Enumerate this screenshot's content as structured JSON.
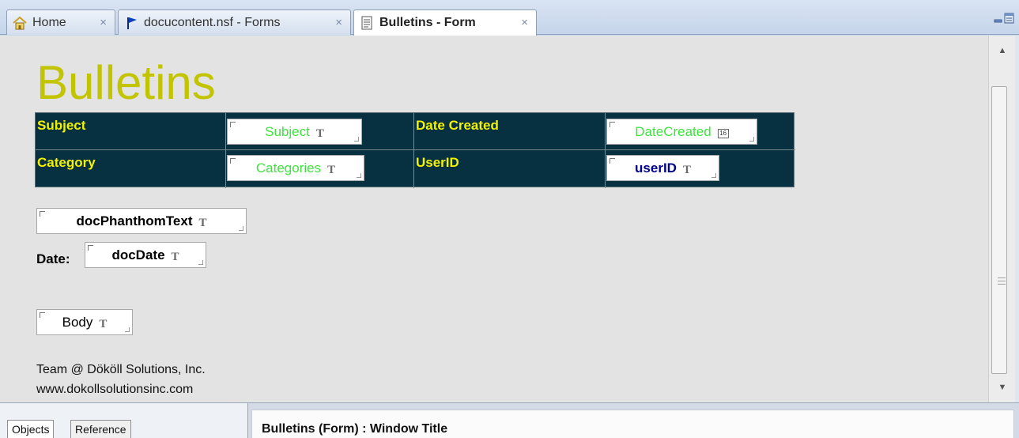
{
  "tabs": [
    {
      "label": "Home",
      "icon": "home-icon",
      "close": "×"
    },
    {
      "label": "docucontent.nsf - Forms",
      "icon": "flag-icon",
      "close": "×"
    },
    {
      "label": "Bulletins - Form",
      "icon": "form-document-icon",
      "close": "×"
    }
  ],
  "form": {
    "title": "Bulletins",
    "table": {
      "subject_label": "Subject",
      "subject_field": "Subject",
      "date_created_label": "Date Created",
      "date_created_field": "DateCreated",
      "category_label": "Category",
      "category_field": "Categories",
      "userid_label": "UserID",
      "userid_field": "userID"
    },
    "phantom_field": "docPhanthomText",
    "date_label": "Date:",
    "date_field": "docDate",
    "body_field": "Body",
    "footer_line1": "Team @ Dököll Solutions, Inc.",
    "footer_line2": "www.dokollsolutionsinc.com",
    "field_type_text_glyph": "T",
    "field_type_date_glyph": "16"
  },
  "bottom": {
    "tabs": [
      "Objects",
      "Reference"
    ],
    "panel_title": "Bulletins (Form) : Window Title"
  },
  "colors": {
    "title": "#c3c400",
    "table_bg": "#073040",
    "table_label": "#f2f200",
    "field_green": "#3ee43e",
    "field_blue": "#00008e"
  }
}
